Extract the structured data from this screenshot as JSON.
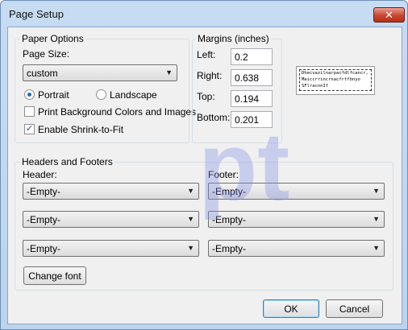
{
  "window": {
    "title": "Page Setup",
    "close_glyph": "✕"
  },
  "paper_options": {
    "group_title": "Paper Options",
    "page_size_label": "Page Size:",
    "page_size_value": "custom",
    "portrait_label": "Portrait",
    "landscape_label": "Landscape",
    "orientation_selected": "Portrait",
    "print_bg_label": "Print Background Colors and Images",
    "print_bg_checked": false,
    "shrink_label": "Enable Shrink-to-Fit",
    "shrink_checked": true
  },
  "margins": {
    "group_title": "Margins (inches)",
    "left_label": "Left:",
    "left_value": "0.2",
    "right_label": "Right:",
    "right_value": "0.638",
    "top_label": "Top:",
    "top_value": "0.194",
    "bottom_label": "Bottom:",
    "bottom_value": "0.201"
  },
  "preview": {
    "lines": [
      "Dhecvazilnarpacfdlfcancr,",
      "Maiccrrincrnacfrtfbnyo",
      "SFlracnnIf"
    ]
  },
  "headers_footers": {
    "group_title": "Headers and Footers",
    "header_label": "Header:",
    "footer_label": "Footer:",
    "header_values": [
      "-Empty-",
      "-Empty-",
      "-Empty-"
    ],
    "footer_values": [
      "-Empty-",
      "-Empty-",
      "-Empty-"
    ],
    "change_font_label": "Change font"
  },
  "buttons": {
    "ok_label": "OK",
    "cancel_label": "Cancel"
  },
  "watermark": {
    "text": "pt"
  },
  "icons": {
    "dropdown": "chevron-down-icon",
    "close": "close-icon"
  }
}
